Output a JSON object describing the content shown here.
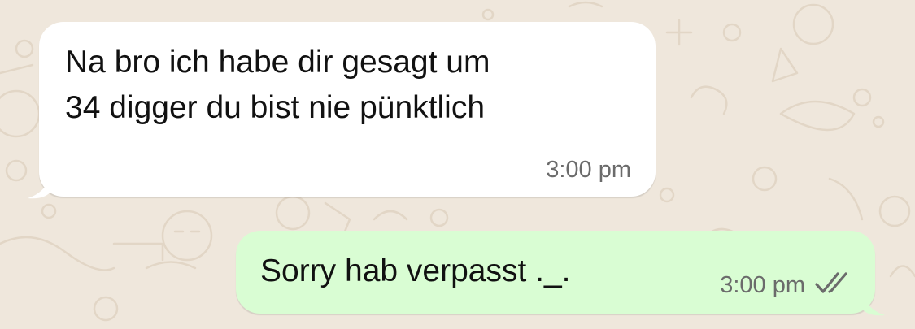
{
  "messages": [
    {
      "direction": "incoming",
      "text": "Na bro ich habe dir gesagt um\n34 digger du bist nie pünktlich",
      "time": "3:00 pm"
    },
    {
      "direction": "outgoing",
      "text": "Sorry hab verpasst ._.",
      "time": "3:00 pm",
      "status_icon": "double-check-icon"
    }
  ],
  "colors": {
    "wallpaper": "#efe7dc",
    "incoming_bubble": "#ffffff",
    "outgoing_bubble": "#d9fdd3",
    "timestamp": "#6b6b6b",
    "read_ticks": "#6b6b6b"
  }
}
